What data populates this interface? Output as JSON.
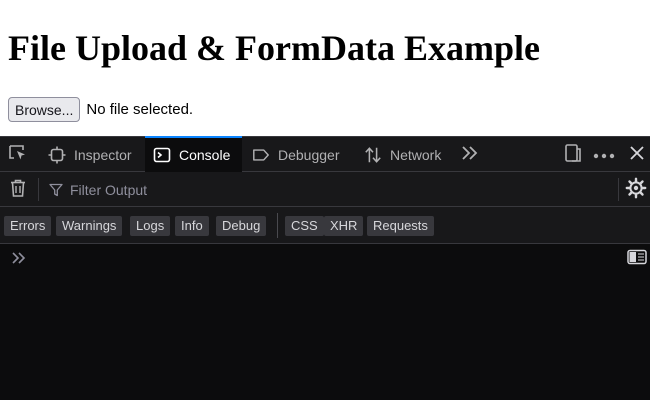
{
  "page": {
    "heading": "File Upload & FormData Example",
    "file_input": {
      "button_label": "Browse...",
      "status": "No file selected."
    }
  },
  "devtools": {
    "toolbar": {
      "tabs": [
        {
          "label": "Inspector",
          "icon": "inspector-icon",
          "selected": false
        },
        {
          "label": "Console",
          "icon": "console-icon",
          "selected": true
        },
        {
          "label": "Debugger",
          "icon": "debugger-icon",
          "selected": false
        },
        {
          "label": "Network",
          "icon": "network-icon",
          "selected": false
        }
      ],
      "icons": [
        "element-picker-icon",
        "more-tabs-icon",
        "responsive-design-icon",
        "more-options-icon",
        "close-icon"
      ]
    },
    "filter": {
      "placeholder": "Filter Output",
      "value": ""
    },
    "levels": [
      "Errors",
      "Warnings",
      "Logs",
      "Info",
      "Debug"
    ],
    "categories": [
      "CSS",
      "XHR",
      "Requests"
    ],
    "colors": {
      "toolbar_bg": "#18181a",
      "console_bg": "#0c0c0d",
      "selected_tab_accent": "#0a84ff",
      "chip_bg": "#38383d",
      "text": "#d7d7db"
    }
  }
}
